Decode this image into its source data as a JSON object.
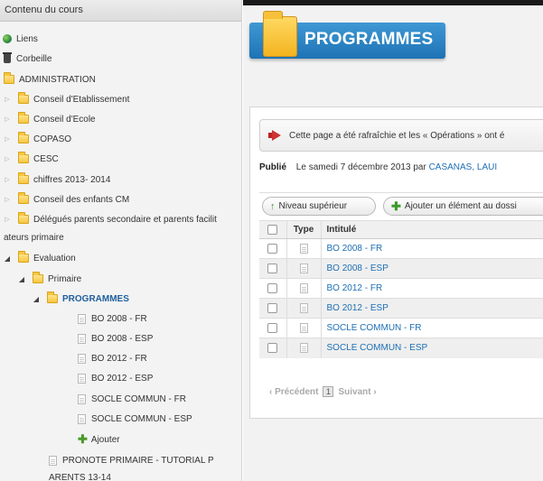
{
  "sidebar": {
    "header": "Contenu du cours",
    "items": [
      {
        "label": "Liens"
      },
      {
        "label": "Corbeille"
      },
      {
        "label": "ADMINISTRATION"
      },
      {
        "label": "Conseil d'Etablissement"
      },
      {
        "label": "Conseil d'Ecole"
      },
      {
        "label": "COPASO"
      },
      {
        "label": "CESC"
      },
      {
        "label": "chiffres 2013- 2014"
      },
      {
        "label": "Conseil des enfants CM"
      },
      {
        "label": "Délégués parents secondaire et parents facilit",
        "label2": "ateurs primaire"
      },
      {
        "label": "Evaluation"
      },
      {
        "label": "Primaire"
      },
      {
        "label": "PROGRAMMES"
      },
      {
        "label": "BO 2008 - FR"
      },
      {
        "label": "BO 2008 - ESP"
      },
      {
        "label": "BO 2012 - FR"
      },
      {
        "label": "BO 2012 - ESP"
      },
      {
        "label": "SOCLE COMMUN - FR"
      },
      {
        "label": "SOCLE COMMUN - ESP"
      },
      {
        "label": "Ajouter"
      },
      {
        "label": "PRONOTE PRIMAIRE - TUTORIAL P",
        "label2": "ARENTS 13-14"
      }
    ]
  },
  "main": {
    "title": "PROGRAMMES",
    "notice": "Cette page a été rafraîchie et les « Opérations » ont é",
    "published_label": "Publié",
    "published_text": "Le samedi 7 décembre 2013 par ",
    "published_author": "CASANAS, LAUI",
    "toolbar": {
      "up_label": "Niveau supérieur",
      "add_label": "Ajouter un élément au dossi"
    },
    "table": {
      "col_type": "Type",
      "col_title": "Intitulé",
      "rows": [
        {
          "title": "BO 2008 - FR"
        },
        {
          "title": "BO 2008 - ESP"
        },
        {
          "title": "BO 2012 - FR"
        },
        {
          "title": "BO 2012 - ESP"
        },
        {
          "title": "SOCLE COMMUN - FR"
        },
        {
          "title": "SOCLE COMMUN - ESP"
        }
      ]
    },
    "pager": {
      "prev": "‹ Précédent",
      "page": "1",
      "next": "Suivant ›"
    }
  },
  "colors": {
    "banner": "#1e73b4",
    "link": "#1f6fb4",
    "folder": "#f7c63f"
  }
}
